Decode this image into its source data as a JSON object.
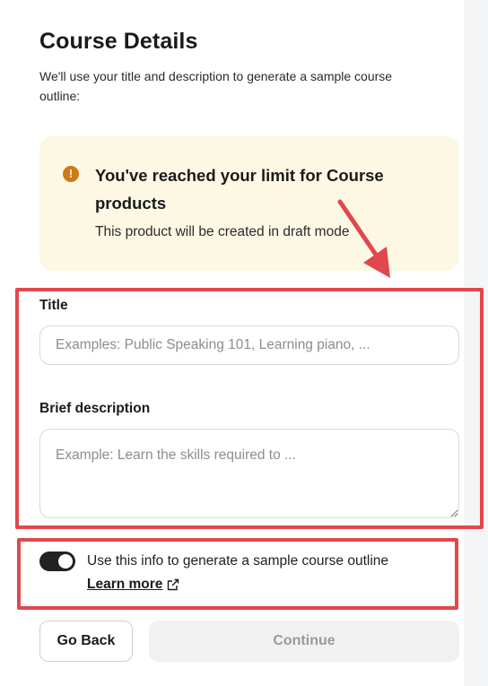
{
  "header": {
    "title": "Course Details",
    "subtitle": "We'll use your title and description to generate a sample course outline:"
  },
  "alert": {
    "icon": "warning-icon",
    "icon_glyph": "!",
    "title": "You've reached your limit for Course products",
    "body": "This product will be created in draft mode",
    "background": "#fdf8e4",
    "icon_color": "#d07a12"
  },
  "form": {
    "title_label": "Title",
    "title_placeholder": "Examples: Public Speaking 101, Learning piano, ...",
    "title_value": "",
    "description_label": "Brief description",
    "description_placeholder": "Example: Learn the skills required to ...",
    "description_value": ""
  },
  "outline_toggle": {
    "enabled": true,
    "label": "Use this info to generate a sample course outline",
    "learn_more": "Learn more",
    "learn_more_icon": "external-link-icon"
  },
  "actions": {
    "back_label": "Go Back",
    "continue_label": "Continue"
  },
  "annotations": {
    "highlight_color": "#e0484d",
    "arrow_icon": "red-arrow-icon"
  }
}
